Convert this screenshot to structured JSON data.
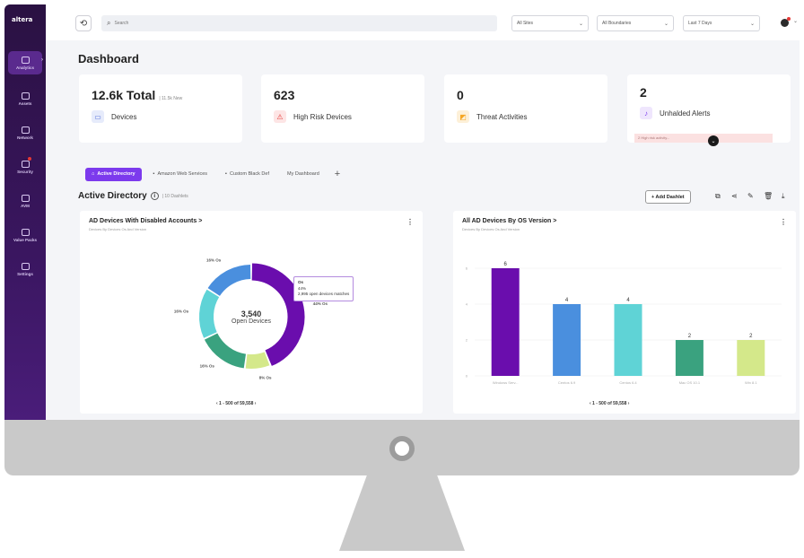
{
  "app": {
    "logo": "altera"
  },
  "sidebar": {
    "items": [
      {
        "label": "Analytics",
        "icon": "analytics-icon",
        "active": true
      },
      {
        "label": "Assets",
        "icon": "assets-icon"
      },
      {
        "label": "Network",
        "icon": "network-icon"
      },
      {
        "label": "Security",
        "icon": "security-icon"
      },
      {
        "label": "AVM",
        "icon": "avm-icon"
      },
      {
        "label": "Value Packs",
        "icon": "value-packs-icon"
      },
      {
        "label": "Settings",
        "icon": "gear-icon"
      }
    ]
  },
  "topbar": {
    "search_placeholder": "Search",
    "filters": [
      {
        "value": "All Sites"
      },
      {
        "value": "All Boundaries"
      },
      {
        "value": "Last 7 Days"
      }
    ]
  },
  "page": {
    "title": "Dashboard"
  },
  "stats": [
    {
      "value": "12.6k Total",
      "sub": "| 11.5k New",
      "label": "Devices",
      "icon": "devices-icon",
      "color": "#4f6bd8"
    },
    {
      "value": "623",
      "sub": "",
      "label": "High Risk Devices",
      "icon": "warning-icon",
      "color": "#e53935"
    },
    {
      "value": "0",
      "sub": "",
      "label": "Threat Activities",
      "icon": "threat-icon",
      "color": "#f5a623"
    },
    {
      "value": "2",
      "sub": "",
      "label": "Unhalded Alerts",
      "icon": "bell-icon",
      "color": "#7c3aed",
      "strip": "2 High risk activity..."
    }
  ],
  "tabs": [
    {
      "label": "Active Directory",
      "active": true
    },
    {
      "label": "Amazon Web Services"
    },
    {
      "label": "Custom Black Def"
    },
    {
      "label": "My Dashboard"
    }
  ],
  "section": {
    "title": "Active Directory",
    "count": "| 10 Dashlets",
    "add_label": "+ Add Dashlet"
  },
  "panels": [
    {
      "title": "AD Devices With Disabled Accounts >",
      "subtitle": "Devices By Devices Os And Version",
      "pager": "‹  1 - 500  of  59,558  ›",
      "center_value": "3,540",
      "center_label": "Open Devices",
      "tooltip": {
        "line1": "Os",
        "line2": "44%",
        "line3": "2,995 open devices matches"
      }
    },
    {
      "title": "All AD Devices By OS Version >",
      "subtitle": "Devices By Devices Os And Version",
      "pager": "‹  1 - 500  of  59,558  ›"
    }
  ],
  "chart_data": [
    {
      "type": "pie",
      "categories": [
        "Os",
        "Os",
        "Os",
        "Os",
        "Os"
      ],
      "values": [
        44,
        8,
        16,
        16,
        16
      ],
      "labels": [
        "44% Os",
        "8% Os",
        "16% Os",
        "16% Os",
        "16% Os"
      ],
      "colors": [
        "#6a0dad",
        "#d4e88a",
        "#3aa27f",
        "#5fd3d6",
        "#4a8fde"
      ]
    },
    {
      "type": "bar",
      "categories": [
        "Windows Serv...",
        "Centos 6.9",
        "Centos 6.4",
        "Mac OS 10.1",
        "Win 8.1"
      ],
      "values": [
        6,
        4,
        4,
        2,
        2
      ],
      "colors": [
        "#6a0dad",
        "#4a8fde",
        "#5fd3d6",
        "#3aa27f",
        "#d4e88a"
      ],
      "ylim": [
        0,
        6
      ]
    }
  ]
}
